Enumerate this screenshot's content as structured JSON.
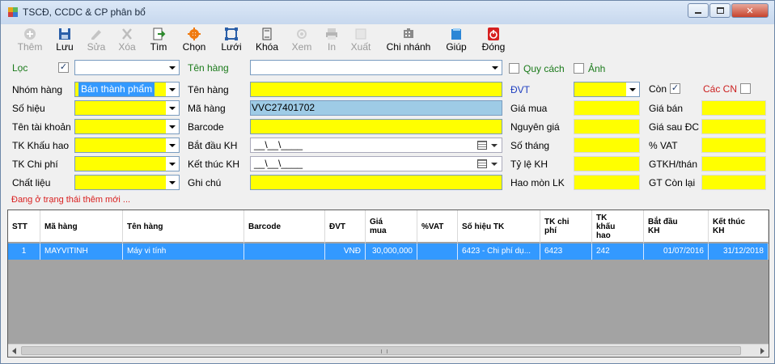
{
  "window": {
    "title": "TSCĐ, CCDC & CP phân bổ"
  },
  "toolbar": [
    {
      "label": "Thêm",
      "icon": "add-icon",
      "enabled": false
    },
    {
      "label": "Lưu",
      "icon": "save-icon",
      "enabled": true
    },
    {
      "label": "Sửa",
      "icon": "edit-icon",
      "enabled": false
    },
    {
      "label": "Xóa",
      "icon": "delete-icon",
      "enabled": false
    },
    {
      "label": "Tìm",
      "icon": "find-icon",
      "enabled": true
    },
    {
      "label": "Chọn",
      "icon": "gear-icon",
      "enabled": true
    },
    {
      "label": "Lưới",
      "icon": "grid-icon",
      "enabled": true
    },
    {
      "label": "Khóa",
      "icon": "lock-icon",
      "enabled": true
    },
    {
      "label": "Xem",
      "icon": "view-icon",
      "enabled": false
    },
    {
      "label": "In",
      "icon": "print-icon",
      "enabled": false
    },
    {
      "label": "Xuất",
      "icon": "export-icon",
      "enabled": false
    },
    {
      "label": "Chi nhánh",
      "icon": "branch-icon",
      "enabled": true
    },
    {
      "label": "Giúp",
      "icon": "help-icon",
      "enabled": true
    },
    {
      "label": "Đóng",
      "icon": "power-icon",
      "enabled": true
    }
  ],
  "filter": {
    "loc_label": "Lọc",
    "loc_checked": "✓",
    "ten_hang_label": "Tên hàng",
    "quy_cach_label": "Quy cách",
    "anh_label": "Ảnh"
  },
  "form": {
    "nhom_hang_label": "Nhóm hàng",
    "nhom_hang_value": "Bán thành phẩm",
    "so_hieu_label": "Số hiệu",
    "ten_tai_khoan_label": "Tên tài khoản",
    "tk_khau_hao_label": "TK Khấu hao",
    "tk_chi_phi_label": "TK Chi phí",
    "chat_lieu_label": "Chất liệu",
    "ten_hang_label": "Tên hàng",
    "ma_hang_label": "Mã hàng",
    "ma_hang_value": "VVC27401702",
    "barcode_label": "Barcode",
    "bat_dau_kh_label": "Bắt đầu KH",
    "bat_dau_kh_value": "__\\__\\____",
    "ket_thuc_kh_label": "Kết thúc KH",
    "ket_thuc_kh_value": "__\\__\\____",
    "ghi_chu_label": "Ghi chú",
    "dvt_label": "ĐVT",
    "gia_mua_label": "Giá mua",
    "nguyen_gia_label": "Nguyên giá",
    "so_thang_label": "Số tháng",
    "ty_le_kh_label": "Tỷ lệ KH",
    "hao_mon_lk_label": "Hao mòn LK",
    "con_label": "Còn",
    "con_checked": "✓",
    "cac_cn_label": "Các CN",
    "gia_ban_label": "Giá bán",
    "gia_sau_dc_label": "Giá sau ĐC",
    "vat_label": "% VAT",
    "gtkh_label": "GTKH/thán",
    "gt_con_lai_label": "GT Còn lại"
  },
  "status": "Đang ở trạng thái thêm mới ...",
  "grid": {
    "columns": [
      {
        "key": "stt",
        "label": "STT"
      },
      {
        "key": "ma_hang",
        "label": "Mã hàng"
      },
      {
        "key": "ten_hang",
        "label": "Tên hàng"
      },
      {
        "key": "barcode",
        "label": "Barcode"
      },
      {
        "key": "dvt",
        "label": "ĐVT"
      },
      {
        "key": "gia_mua",
        "label": "Giá\nmua"
      },
      {
        "key": "vat",
        "label": "%VAT"
      },
      {
        "key": "so_hieu_tk",
        "label": "Số hiệu TK"
      },
      {
        "key": "tk_chi_phi",
        "label": "TK chi\nphí"
      },
      {
        "key": "tk_khau_hao",
        "label": "TK\nkhấu\nhao"
      },
      {
        "key": "bat_dau_kh",
        "label": "Bắt đầu\nKH"
      },
      {
        "key": "ket_thuc_kh",
        "label": "Kết thúc\nKH"
      }
    ],
    "rows": [
      {
        "stt": "1",
        "ma_hang": "MAYVITINH",
        "ten_hang": "Máy vi tính",
        "barcode": "",
        "dvt": "VNĐ",
        "gia_mua": "30,000,000",
        "vat": "",
        "so_hieu_tk": "6423 - Chi phí dụ...",
        "tk_chi_phi": "6423",
        "tk_khau_hao": "242",
        "bat_dau_kh": "01/07/2016",
        "ket_thuc_kh": "31/12/2018"
      }
    ]
  }
}
